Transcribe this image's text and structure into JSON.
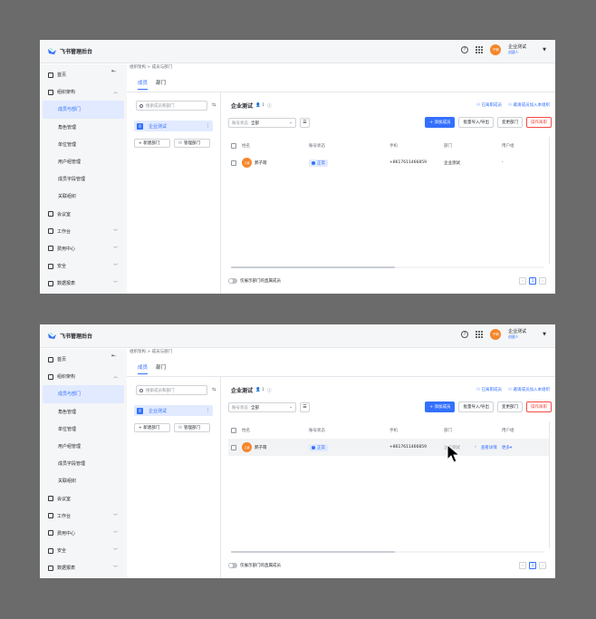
{
  "app": {
    "title": "飞书管理后台",
    "org_name": "企业测试",
    "org_role": "创建人",
    "avatar_text": "子萌"
  },
  "sidebar": {
    "items": [
      {
        "label": "首页",
        "icon": "home-icon",
        "level": 1
      },
      {
        "label": "组织架构",
        "icon": "org-icon",
        "level": 1,
        "expanded": true
      },
      {
        "label": "成员与部门",
        "level": 2,
        "active": true
      },
      {
        "label": "角色管理",
        "level": 2
      },
      {
        "label": "单位管理",
        "level": 2
      },
      {
        "label": "用户组管理",
        "level": 2
      },
      {
        "label": "成员字段管理",
        "level": 2
      },
      {
        "label": "关联组织",
        "level": 2
      },
      {
        "label": "会议室",
        "icon": "meeting-room-icon",
        "level": 1
      },
      {
        "label": "工作台",
        "icon": "workplace-icon",
        "level": 1,
        "has_children": true
      },
      {
        "label": "费用中心",
        "icon": "billing-icon",
        "level": 1,
        "has_children": true
      },
      {
        "label": "安全",
        "icon": "security-icon",
        "level": 1,
        "has_children": true
      },
      {
        "label": "数据报表",
        "icon": "report-icon",
        "level": 1,
        "has_children": true
      }
    ]
  },
  "breadcrumb": {
    "parent": "组织架构",
    "current": "成员与部门"
  },
  "tabs": [
    {
      "label": "成员",
      "active": true
    },
    {
      "label": "部门",
      "active": false
    }
  ],
  "left_pane": {
    "search_placeholder": "搜索成员和部门",
    "tree_item": {
      "badge": "企",
      "label": "企业测试"
    },
    "new_dept_label": "+ 新建部门",
    "manage_dept_label": "管理部门"
  },
  "right_pane": {
    "title": "企业测试",
    "count": "1",
    "links": [
      "已离职成员",
      "邀请成员加入本组织"
    ],
    "status_filter": {
      "label": "账号状态",
      "value": "全部"
    },
    "buttons": {
      "add": "+ 添加成员",
      "import": "批量导入/导出",
      "change_dept": "变更部门",
      "logs": "操作离职"
    }
  },
  "table": {
    "headers": [
      "姓名",
      "账号状态",
      "手机",
      "部门",
      "用户组"
    ],
    "rows": [
      {
        "name": "郝子萌",
        "avatar": "子萌",
        "status": "正常",
        "phone": "+8617611466859",
        "dept": "企业测试",
        "group": "-"
      }
    ],
    "row_ops": {
      "detail": "查看详情",
      "more": "更多"
    }
  },
  "footer": {
    "toggle_label": "仅展示部门的直属成员",
    "page": "1"
  },
  "colors": {
    "accent": "#3370ff",
    "danger": "#f54a45",
    "avatar": "#f5862b"
  }
}
